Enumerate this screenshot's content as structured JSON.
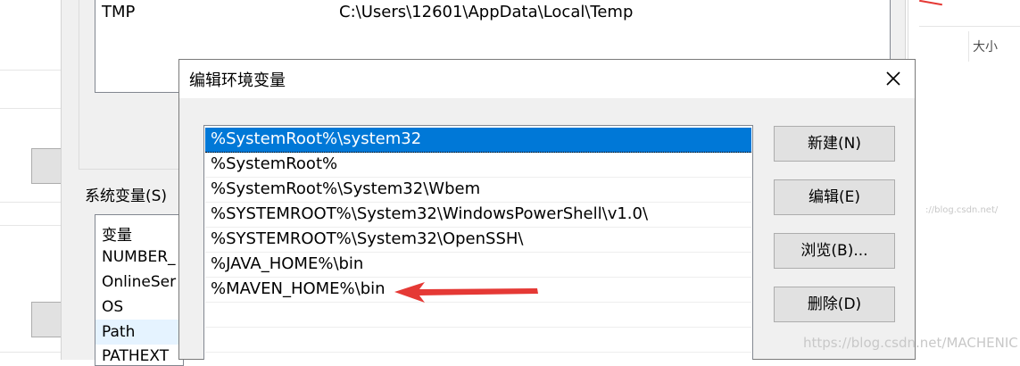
{
  "background": {
    "user_var_row": {
      "name": "TMP",
      "value": "C:\\Users\\12601\\AppData\\Local\\Temp"
    },
    "system_vars_label": "系统变量(S)",
    "system_vars_rows": [
      "变量",
      "NUMBER_",
      "OnlineSer",
      "OS",
      "Path",
      "PATHEXT"
    ],
    "right_panel_column_label": "大小"
  },
  "dialog": {
    "title": "编辑环境变量",
    "paths": [
      "%SystemRoot%\\system32",
      "%SystemRoot%",
      "%SystemRoot%\\System32\\Wbem",
      "%SYSTEMROOT%\\System32\\WindowsPowerShell\\v1.0\\",
      "%SYSTEMROOT%\\System32\\OpenSSH\\",
      "%JAVA_HOME%\\bin",
      "%MAVEN_HOME%\\bin",
      "",
      ""
    ],
    "selected_index": 0,
    "buttons": {
      "new": "新建(N)",
      "edit": "编辑(E)",
      "browse": "浏览(B)...",
      "delete": "删除(D)"
    }
  },
  "watermarks": {
    "right": "https://blog.csdn.net/MACHENIC",
    "mid": "://blog.csdn.net/"
  },
  "colors": {
    "selection": "#0078d7",
    "annotation_arrow": "#e53935",
    "selected_sys_row": "#e5f3ff"
  },
  "icons": {
    "close": "close-icon",
    "arrow": "red-arrow-annotation"
  }
}
